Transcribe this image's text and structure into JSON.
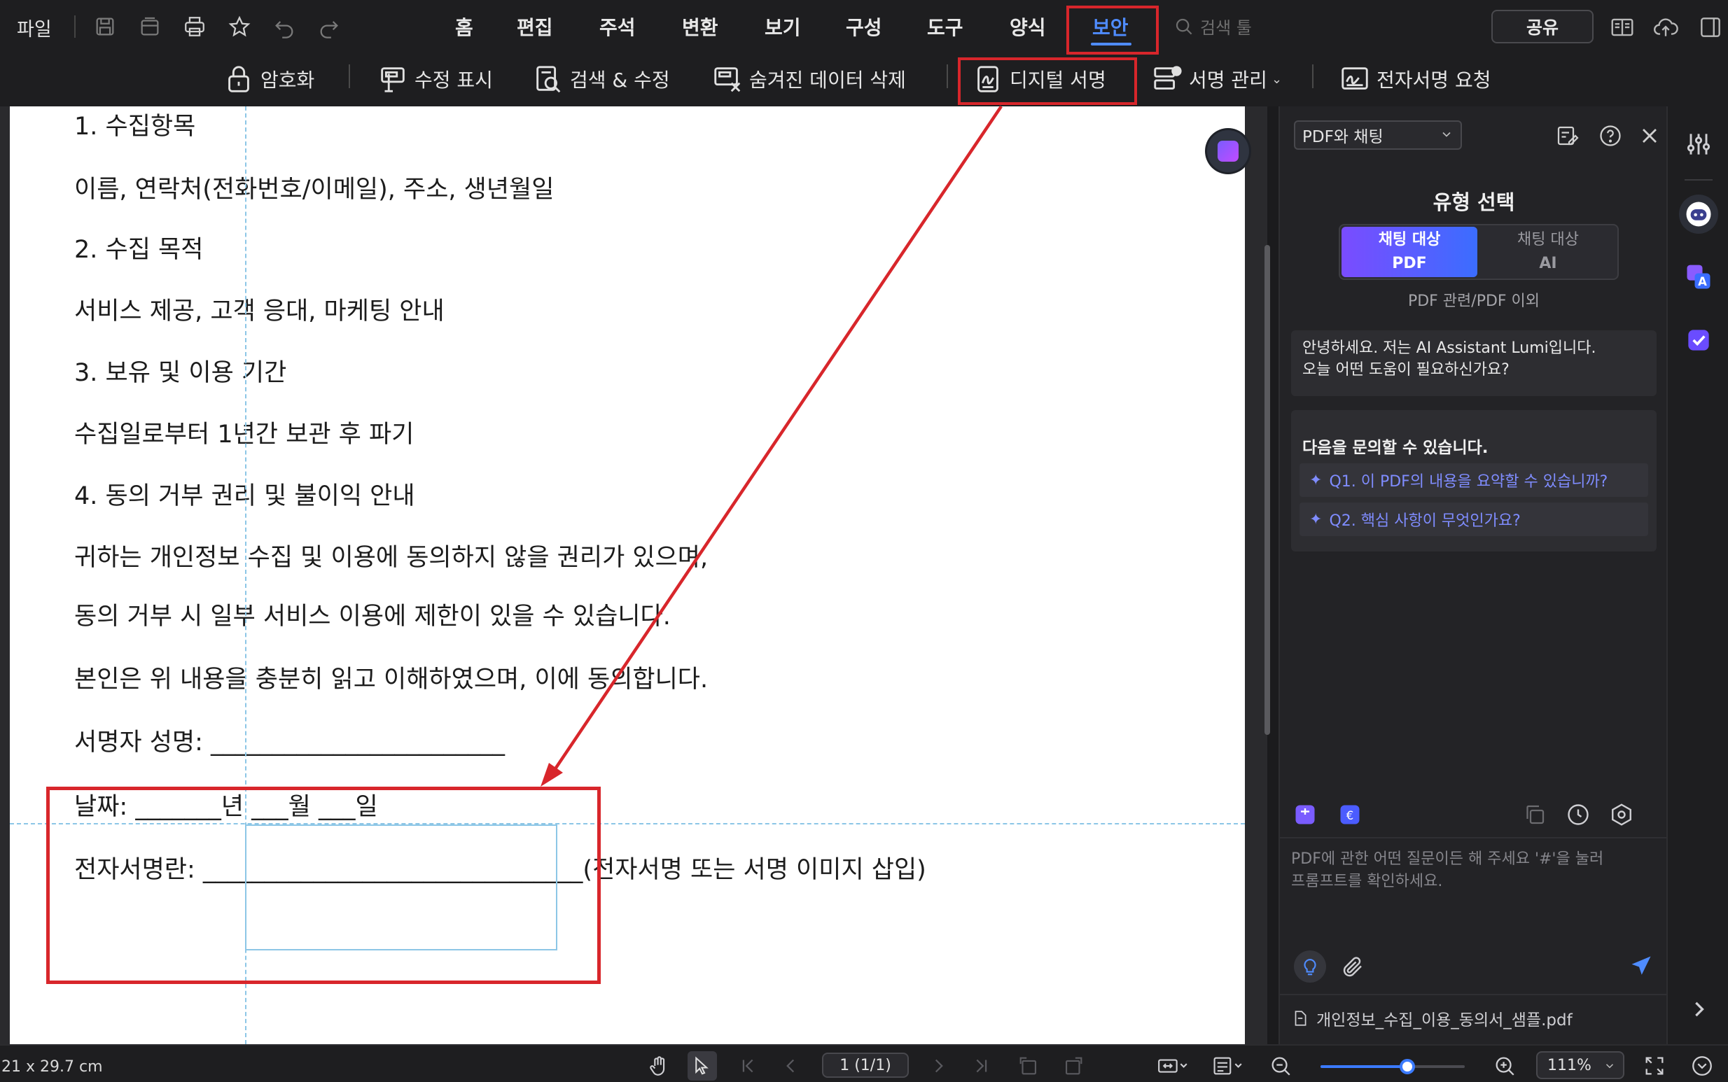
{
  "menubar": {
    "file": "파일",
    "tabs": [
      "홈",
      "편집",
      "주석",
      "변환",
      "보기",
      "구성",
      "도구",
      "양식",
      "보안"
    ],
    "active_tab": "보안",
    "search_tool": "검색 툴",
    "share": "공유"
  },
  "ribbon": {
    "items": [
      "암호화",
      "수정 표시",
      "검색 & 수정",
      "숨겨진 데이터 삭제",
      "디지털 서명",
      "서명 관리",
      "전자서명 요청"
    ],
    "highlighted": "디지털 서명"
  },
  "document": {
    "lines": [
      "1. 수집항목",
      "이름, 연락처(전화번호/이메일), 주소, 생년월일",
      "2. 수집 목적",
      "서비스 제공, 고객 응대, 마케팅 안내",
      "3. 보유 및 이용 기간",
      "수집일로부터 1년간 보관 후 파기",
      "4. 동의 거부 권리 및 불이익 안내",
      "귀하는 개인정보 수집 및 이용에 동의하지 않을 권리가 있으며,",
      "동의 거부 시 일부 서비스 이용에 제한이 있을 수 있습니다.",
      "본인은 위 내용을 충분히 읽고 이해하였으며, 이에 동의합니다.",
      "서명자 성명: ________________________",
      "날짜: _______년 ___월 ___일",
      "전자서명란: _______________________________(전자서명 또는 서명 이미지 삽입)"
    ]
  },
  "panel": {
    "mode_select": "PDF와 채팅",
    "title": "유형 선택",
    "seg_pdf_top": "채팅 대상",
    "seg_pdf_bottom": "PDF",
    "seg_ai_top": "채팅 대상",
    "seg_ai_bottom": "AI",
    "seg_caption": "PDF 관련/PDF 이외",
    "greeting_1": "안녕하세요. 저는 AI Assistant Lumi입니다.",
    "greeting_2": "오늘 어떤 도움이 필요하신가요?",
    "suggest_title": "다음을 문의할 수 있습니다.",
    "q1": "Q1. 이 PDF의 내용을 요약할 수 있습니까?",
    "q2": "Q2. 핵심 사항이 무엇인가요?",
    "input_placeholder_1": "PDF에 관한 어떤 질문이든 해 주세요 '#'을 눌러",
    "input_placeholder_2": "프롬프트를 확인하세요.",
    "filename": "개인정보_수집_이용_동의서_샘플.pdf"
  },
  "statusbar": {
    "page_size": "21 x 29.7 cm",
    "page_indicator": "1 (1/1)",
    "zoom": "111%",
    "zoom_slider_level": 0.6
  },
  "colors": {
    "accent": "#4f8cff",
    "highlight_red": "#d8262b",
    "guide": "#8cc6e6",
    "ai_gradient_start": "#7a4cff",
    "ai_gradient_end": "#3b6dff"
  },
  "icons": {
    "quick_access": [
      "save-icon",
      "stack-icon",
      "print-icon",
      "star-icon",
      "undo-icon",
      "redo-icon"
    ],
    "ribbon": [
      "lock-icon",
      "redact-mark-icon",
      "search-redact-icon",
      "remove-hidden-data-icon",
      "digital-signature-icon",
      "signature-manage-icon",
      "esign-request-icon"
    ]
  }
}
